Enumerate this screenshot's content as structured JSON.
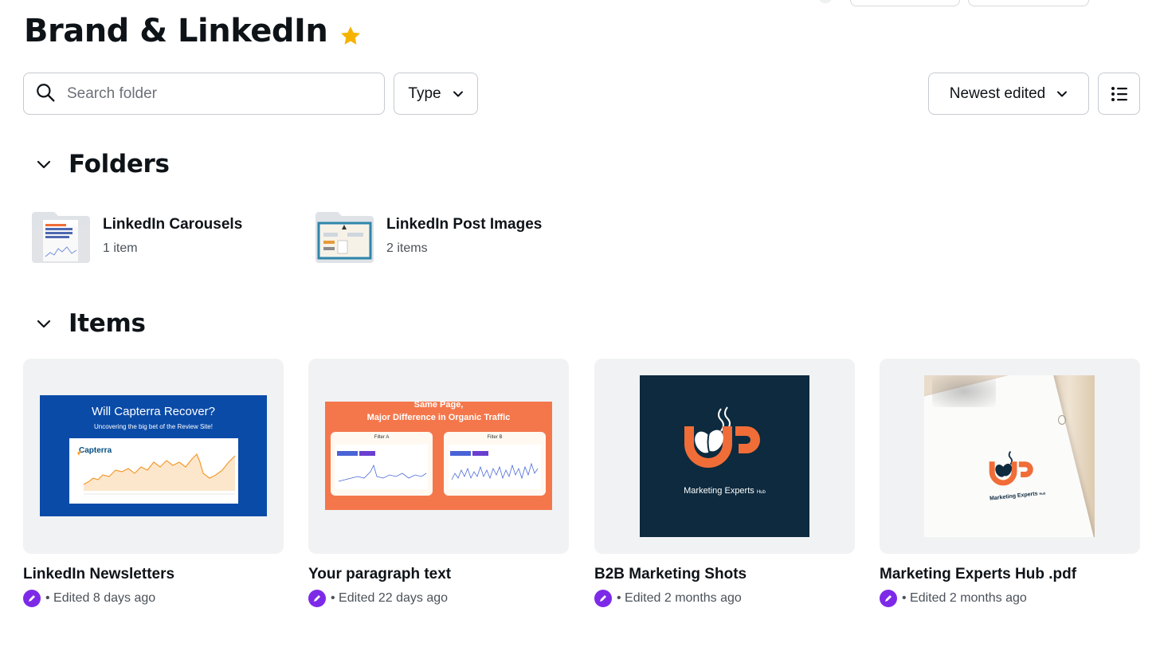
{
  "page": {
    "title": "Brand & LinkedIn"
  },
  "toolbar": {
    "search_placeholder": "Search folder",
    "type_label": "Type",
    "sort_label": "Newest edited"
  },
  "folders_section": {
    "heading": "Folders",
    "items": [
      {
        "name": "LinkedIn Carousels",
        "count": "1 item"
      },
      {
        "name": "LinkedIn Post Images",
        "count": "2 items"
      }
    ]
  },
  "items_section": {
    "heading": "Items",
    "cards": [
      {
        "title": "LinkedIn Newsletters",
        "edited": "• Edited 8 days ago",
        "thumb": {
          "headline": "Will Capterra Recover?",
          "subline": "Uncovering the big bet of the Review Site!",
          "logo": "Capterra"
        }
      },
      {
        "title": "Your paragraph text",
        "edited": "• Edited 22 days ago",
        "thumb": {
          "headline": "Same Page,",
          "subline": "Major Difference in Organic Traffic",
          "panel_a": "Filter A",
          "panel_b": "Filter B"
        }
      },
      {
        "title": "B2B Marketing Shots",
        "edited": "• Edited 2 months ago",
        "thumb": {
          "brand": "Marketing Experts",
          "brand_small": "Hub"
        }
      },
      {
        "title": "Marketing Experts Hub .pdf",
        "edited": "• Edited 2 months ago",
        "thumb": {
          "brand": "Marketing Experts",
          "brand_small": "Hub"
        }
      }
    ]
  },
  "colors": {
    "accent_purple": "#7d2ae8",
    "star": "#f5b300",
    "brand_orange": "#f06d38",
    "navy": "#0d2a3e",
    "capterra_blue": "#0a4ba8"
  },
  "icons": [
    "star-icon",
    "search-icon",
    "chevron-down-icon",
    "list-view-icon",
    "edit-badge-icon"
  ]
}
